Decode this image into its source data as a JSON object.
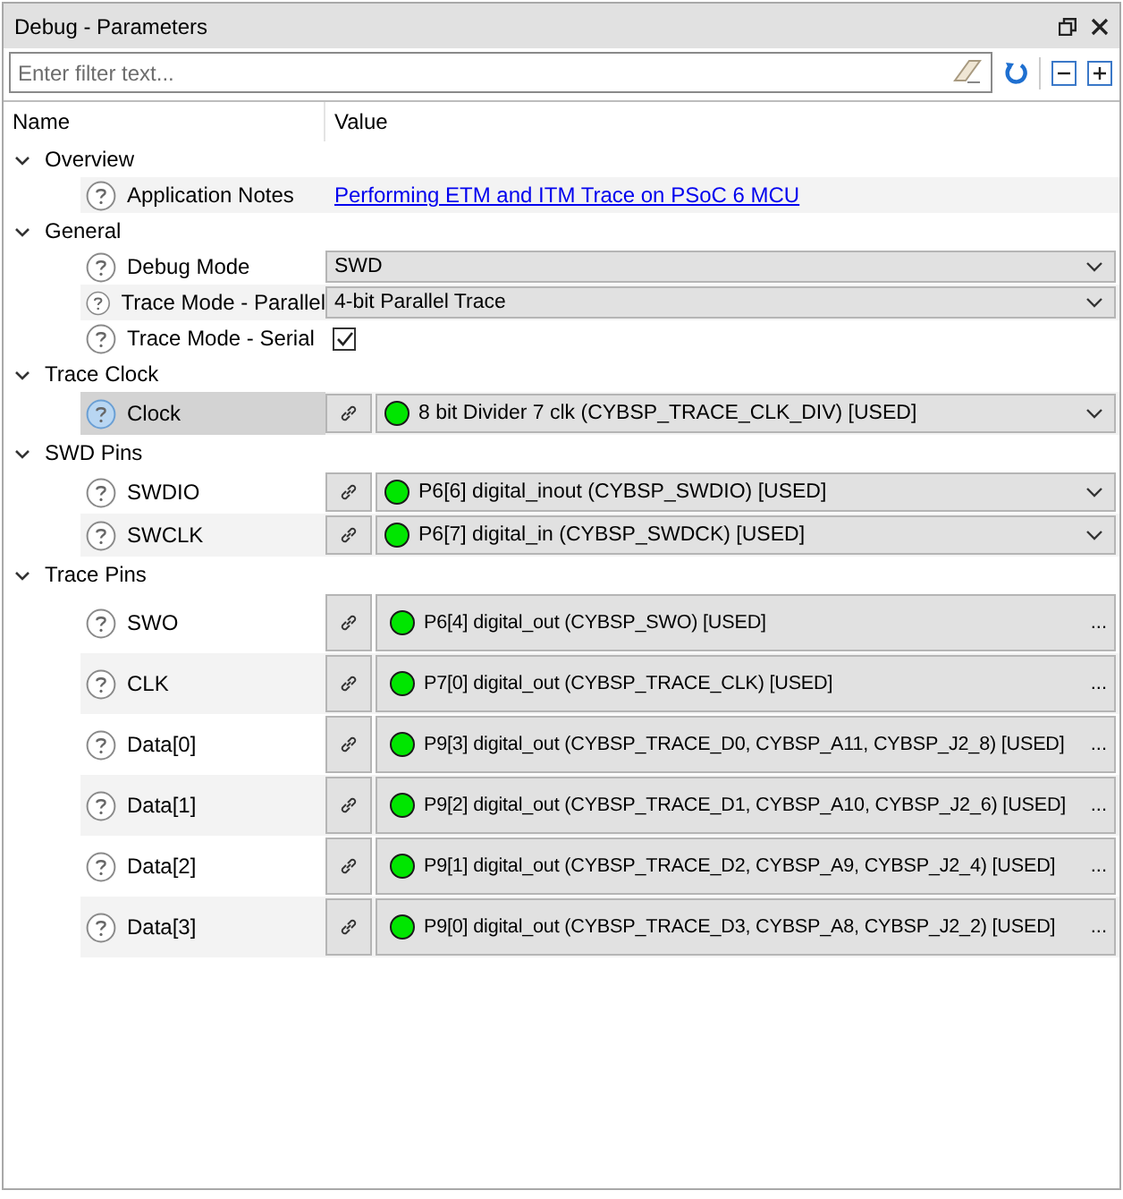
{
  "window": {
    "title": "Debug - Parameters"
  },
  "filter": {
    "placeholder": "Enter filter text..."
  },
  "columns": [
    "Name",
    "Value"
  ],
  "groups": [
    {
      "label": "Overview",
      "expanded": true,
      "params": [
        {
          "kind": "link",
          "name": "Application Notes",
          "value": "Performing ETM and ITM Trace on PSoC 6 MCU",
          "selected": false
        }
      ]
    },
    {
      "label": "General",
      "expanded": true,
      "params": [
        {
          "kind": "select",
          "name": "Debug Mode",
          "value": "SWD",
          "selected": false
        },
        {
          "kind": "select",
          "name": "Trace Mode - Parallel",
          "value": "4-bit Parallel Trace",
          "selected": false
        },
        {
          "kind": "checkbox",
          "name": "Trace Mode - Serial",
          "checked": true,
          "selected": false
        }
      ]
    },
    {
      "label": "Trace Clock",
      "expanded": true,
      "params": [
        {
          "kind": "resource",
          "name": "Clock",
          "value": "8 bit Divider 7 clk (CYBSP_TRACE_CLK_DIV) [USED]",
          "color": "#00e600",
          "selected": true
        }
      ]
    },
    {
      "label": "SWD Pins",
      "expanded": true,
      "params": [
        {
          "kind": "resource",
          "name": "SWDIO",
          "value": "P6[6] digital_inout (CYBSP_SWDIO) [USED]",
          "color": "#00e600",
          "selected": false
        },
        {
          "kind": "resource",
          "name": "SWCLK",
          "value": "P6[7] digital_in (CYBSP_SWDCK) [USED]",
          "color": "#00e600",
          "selected": false
        }
      ]
    },
    {
      "label": "Trace Pins",
      "expanded": true,
      "params": [
        {
          "kind": "picker",
          "name": "SWO",
          "value": "P6[4] digital_out (CYBSP_SWO) [USED]",
          "more": "...",
          "color": "#00e600",
          "selected": false
        },
        {
          "kind": "picker",
          "name": "CLK",
          "value": "P7[0] digital_out (CYBSP_TRACE_CLK) [USED]",
          "more": "...",
          "color": "#00e600",
          "selected": false
        },
        {
          "kind": "picker",
          "name": "Data[0]",
          "value": "P9[3] digital_out (CYBSP_TRACE_D0, CYBSP_A11, CYBSP_J2_8) [USED]",
          "more": "...",
          "color": "#00e600",
          "selected": false
        },
        {
          "kind": "picker",
          "name": "Data[1]",
          "value": "P9[2] digital_out (CYBSP_TRACE_D1, CYBSP_A10, CYBSP_J2_6) [USED]",
          "more": "...",
          "color": "#00e600",
          "selected": false
        },
        {
          "kind": "picker",
          "name": "Data[2]",
          "value": "P9[1] digital_out (CYBSP_TRACE_D2, CYBSP_A9, CYBSP_J2_4) [USED]",
          "more": "...",
          "color": "#00e600",
          "selected": false
        },
        {
          "kind": "picker",
          "name": "Data[3]",
          "value": "P9[0] digital_out (CYBSP_TRACE_D3, CYBSP_A8, CYBSP_J2_2) [USED]",
          "more": "...",
          "color": "#00e600",
          "selected": false
        }
      ]
    }
  ]
}
